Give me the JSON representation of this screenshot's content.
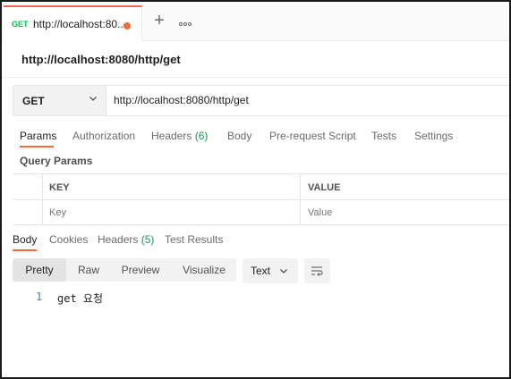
{
  "tab": {
    "method": "GET",
    "title": "http://localhost:80...",
    "unsaved_dot_color": "#f26b3a"
  },
  "tab_actions": {
    "add_icon": "plus-icon",
    "add_label": "+",
    "more_icon": "ellipsis-icon"
  },
  "request": {
    "name": "http://localhost:8080/http/get",
    "method": "GET",
    "url": "http://localhost:8080/http/get"
  },
  "request_tabs": {
    "params": "Params",
    "authorization": "Authorization",
    "headers": "Headers",
    "headers_count": "(6)",
    "body": "Body",
    "prerequest": "Pre-request Script",
    "tests": "Tests",
    "settings": "Settings"
  },
  "query_params": {
    "title": "Query Params",
    "key_header": "KEY",
    "value_header": "VALUE",
    "key_placeholder": "Key",
    "value_placeholder": "Value"
  },
  "response_tabs": {
    "body": "Body",
    "cookies": "Cookies",
    "headers": "Headers",
    "headers_count": "(5)",
    "test_results": "Test Results"
  },
  "response_toolbar": {
    "modes": [
      "Pretty",
      "Raw",
      "Preview",
      "Visualize"
    ],
    "active_mode": "Pretty",
    "language": "Text",
    "wrap_icon": "wrap-lines-icon"
  },
  "response_body": {
    "lines": [
      {
        "number": "1",
        "text": "get 요청"
      }
    ]
  },
  "colors": {
    "accent": "#f26b3a",
    "get_method": "#0cbb52",
    "count_green": "#0f9d58"
  }
}
